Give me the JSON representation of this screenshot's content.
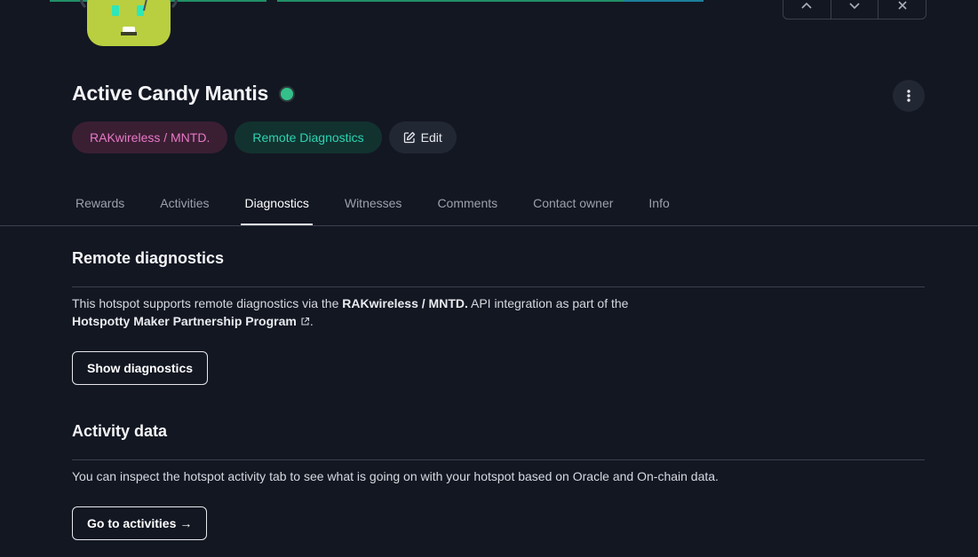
{
  "colors": {
    "background": "#131722",
    "accent_green": "#34c08a",
    "maker_chip_text": "#e879c6",
    "diag_chip_text": "#2dd4b2"
  },
  "hotspot": {
    "name": "Active Candy Mantis",
    "status": "online"
  },
  "chips": {
    "maker": "RAKwireless / MNTD.",
    "diagnostics": "Remote Diagnostics",
    "edit": "Edit"
  },
  "tabs": [
    {
      "label": "Rewards"
    },
    {
      "label": "Activities"
    },
    {
      "label": "Diagnostics",
      "active": true
    },
    {
      "label": "Witnesses"
    },
    {
      "label": "Comments"
    },
    {
      "label": "Contact owner"
    },
    {
      "label": "Info"
    }
  ],
  "remote": {
    "title": "Remote diagnostics",
    "text_before": "This hotspot supports remote diagnostics via the ",
    "maker_bold": "RAKwireless / MNTD.",
    "text_after": " API integration as part of the",
    "program_link": "Hotspotty Maker Partnership Program",
    "period": ".",
    "button": "Show diagnostics"
  },
  "activity": {
    "title": "Activity data",
    "text": "You can inspect the hotspot activity tab to see what is going on with your hotspot based on Oracle and On-chain data.",
    "button": "Go to activities",
    "button_arrow": "→"
  },
  "icons": {
    "edit": "edit-pencil-icon",
    "external": "external-link-icon",
    "menu": "vertical-dots-icon",
    "robot": "robot-avatar"
  }
}
